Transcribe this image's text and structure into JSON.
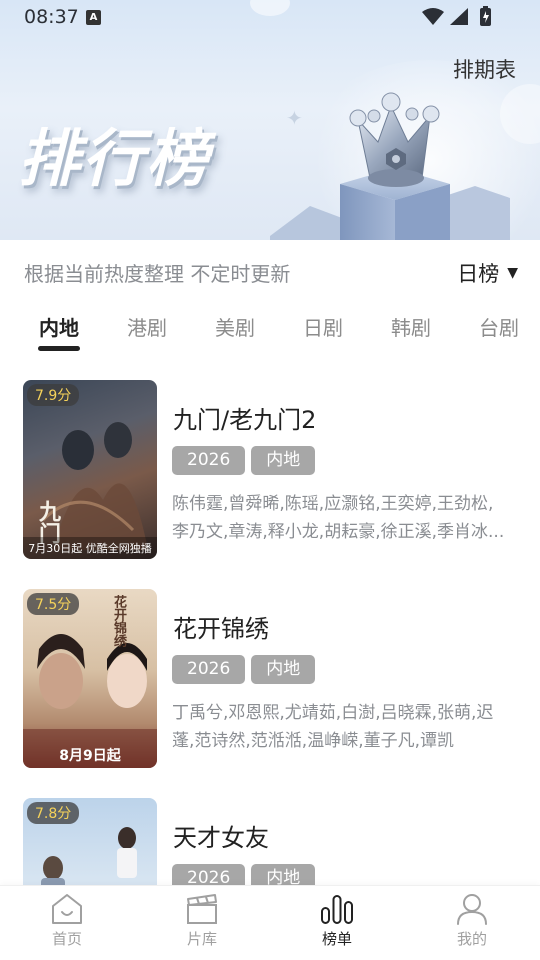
{
  "status_bar": {
    "time": "08:37",
    "notification_badge": "A"
  },
  "header": {
    "schedule_label": "排期表",
    "banner_title": "排行榜"
  },
  "subtitle": "根据当前热度整理 不定时更新",
  "sort": {
    "selected": "日榜"
  },
  "tabs": [
    {
      "label": "内地",
      "active": true
    },
    {
      "label": "港剧",
      "active": false
    },
    {
      "label": "美剧",
      "active": false
    },
    {
      "label": "日剧",
      "active": false
    },
    {
      "label": "韩剧",
      "active": false
    },
    {
      "label": "台剧",
      "active": false
    }
  ],
  "dramas": [
    {
      "title": "九门/老九门2",
      "rating": "7.9分",
      "year": "2026",
      "region": "内地",
      "cast_line1": "陈伟霆,曾舜晞,陈瑶,应灏铭,王奕婷,王劲松,",
      "cast_line2": "李乃文,章涛,释小龙,胡耘豪,徐正溪,季肖冰...",
      "poster_title": "九门",
      "poster_tagline": "7月30日起 优酷全网独播"
    },
    {
      "title": "花开锦绣",
      "rating": "7.5分",
      "year": "2026",
      "region": "内地",
      "cast_line1": "丁禹兮,邓恩熙,尤靖茹,白澍,吕晓霖,张萌,迟",
      "cast_line2": "蓬,范诗然,范湉湉,温峥嵘,董子凡,谭凯",
      "poster_title": "花开锦绣",
      "poster_tagline": "8月9日起"
    },
    {
      "title": "天才女友",
      "rating": "7.8分",
      "year": "2026",
      "region": "内地",
      "cast_line1": "",
      "cast_line2": "",
      "poster_title": "",
      "poster_tagline": ""
    }
  ],
  "bottom_nav": [
    {
      "label": "首页",
      "icon": "home-icon",
      "active": false
    },
    {
      "label": "片库",
      "icon": "clapperboard-icon",
      "active": false
    },
    {
      "label": "榜单",
      "icon": "bar-chart-icon",
      "active": true
    },
    {
      "label": "我的",
      "icon": "user-icon",
      "active": false
    }
  ],
  "colors": {
    "chip_bg": "#a7a7a7",
    "rating_text": "#f5d25a",
    "active_text": "#222222",
    "inactive_text": "#8c8c8c"
  }
}
